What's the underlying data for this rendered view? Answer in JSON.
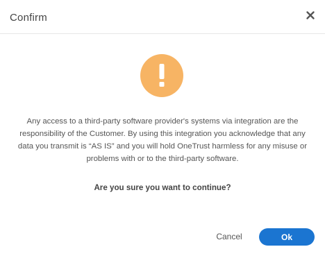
{
  "dialog": {
    "title": "Confirm",
    "close_icon": "close-icon",
    "warning_icon": "exclamation-icon",
    "warning_color": "#f7b464",
    "message": "Any access to a third-party software provider's systems via integration are the responsibility of the Customer. By using this integration you acknowledge that any data you transmit is “AS IS” and you will hold OneTrust harmless for any misuse or problems with or to the third-party software.",
    "question": "Are you sure you want to continue?",
    "buttons": {
      "cancel_label": "Cancel",
      "ok_label": "Ok",
      "ok_color": "#1b75d1"
    }
  }
}
